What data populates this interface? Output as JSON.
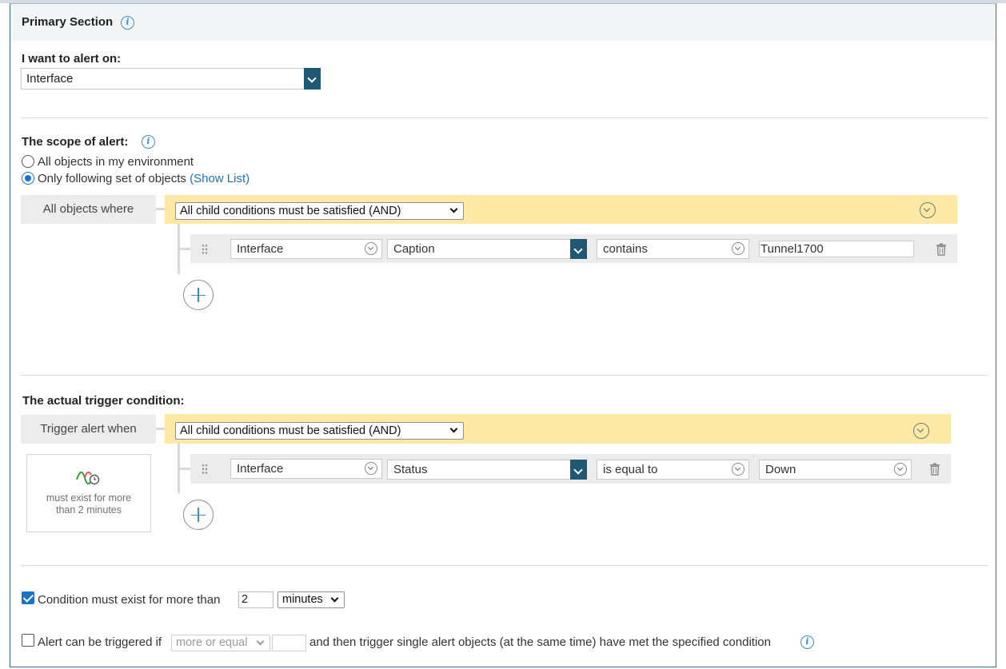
{
  "primary_section": {
    "title": "Primary Section"
  },
  "alert_on": {
    "label": "I want to alert on:",
    "value": "Interface"
  },
  "scope": {
    "label": "The scope of alert:",
    "option_all": "All objects in my environment",
    "option_following": "Only following set of objects",
    "show_list": "(Show List)",
    "selected": "following",
    "group_label": "All objects where",
    "group_operator": "All child conditions must be satisfied (AND)",
    "condition": {
      "object": "Interface",
      "field": "Caption",
      "operator": "contains",
      "value": "Tunnel1700"
    }
  },
  "trigger": {
    "label": "The actual trigger condition:",
    "group_label": "Trigger alert when",
    "group_operator": "All child conditions must be satisfied (AND)",
    "card_text": "must exist for more than 2 minutes",
    "condition": {
      "object": "Interface",
      "field": "Status",
      "operator": "is equal to",
      "value": "Down"
    }
  },
  "duration": {
    "checked": true,
    "label": "Condition must exist for more than",
    "value": "2",
    "unit": "minutes"
  },
  "multi": {
    "checked": false,
    "label_prefix": "Alert can be triggered if",
    "comparator": "more or equal",
    "count": "",
    "label_suffix": "and then trigger single alert objects (at the same time) have met the specified condition"
  },
  "icons": {
    "info": "info-icon",
    "trash": "trash-icon",
    "add": "plus-icon",
    "drag": "drag-handle-icon",
    "trigger_card": "chart-clock-icon"
  },
  "colors": {
    "accent_dark": "#1e5875",
    "link": "#1e73b8",
    "group_bar": "#fde9a6",
    "row_bg": "#ececec"
  }
}
